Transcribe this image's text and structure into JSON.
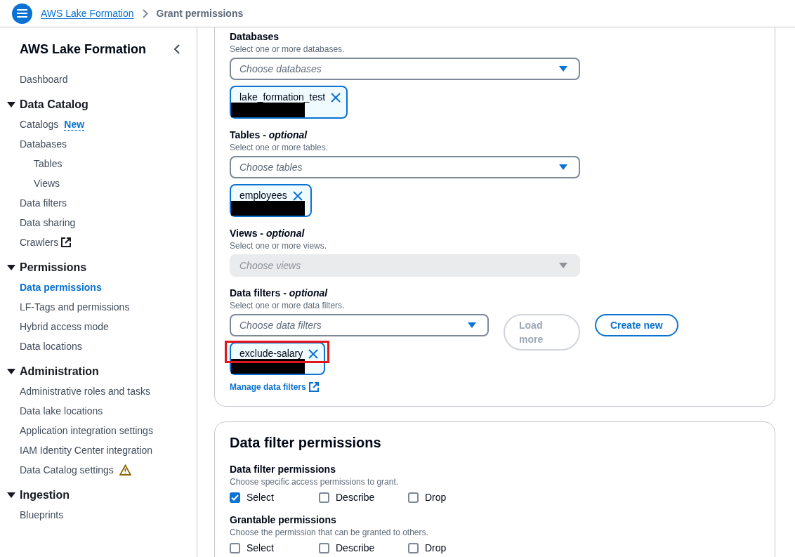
{
  "header": {
    "breadcrumbs": [
      {
        "label": "AWS Lake Formation",
        "link": true
      },
      {
        "label": "Grant permissions",
        "link": false
      }
    ]
  },
  "sidebar": {
    "title": "AWS Lake Formation",
    "items": [
      {
        "label": "Dashboard",
        "selected": false
      },
      {
        "label": "Data Catalog",
        "kind": "section",
        "expanded": true,
        "children": [
          {
            "label": "Catalogs",
            "selected": false,
            "badge": "New"
          },
          {
            "label": "Databases",
            "selected": false,
            "children": [
              {
                "label": "Tables",
                "selected": false
              },
              {
                "label": "Views",
                "selected": false
              }
            ]
          },
          {
            "label": "Data filters",
            "selected": false
          },
          {
            "label": "Data sharing",
            "selected": false
          },
          {
            "label": "Crawlers",
            "selected": false,
            "kind": "external"
          }
        ]
      },
      {
        "label": "Permissions",
        "kind": "section",
        "expanded": true,
        "children": [
          {
            "label": "Data permissions",
            "selected": true
          },
          {
            "label": "LF-Tags and permissions",
            "selected": false
          },
          {
            "label": "Hybrid access mode",
            "selected": false
          },
          {
            "label": "Data locations",
            "selected": false
          }
        ]
      },
      {
        "label": "Administration",
        "kind": "section",
        "expanded": true,
        "children": [
          {
            "label": "Administrative roles and tasks",
            "selected": false
          },
          {
            "label": "Data lake locations",
            "selected": false
          },
          {
            "label": "Application integration settings",
            "selected": false
          },
          {
            "label": "IAM Identity Center integration",
            "selected": false
          },
          {
            "label": "Data Catalog settings",
            "selected": false,
            "kind": "warning"
          }
        ]
      },
      {
        "label": "Ingestion",
        "kind": "section",
        "expanded": true,
        "children": [
          {
            "label": "Blueprints",
            "selected": false
          }
        ]
      }
    ]
  },
  "resource_card": {
    "fields": [
      {
        "label": "Databases",
        "description": "Select one or more databases.",
        "placeholder": "Choose databases",
        "disabled": false,
        "tokens": [
          {
            "label": "lake_formation_test",
            "highlighted": false
          }
        ]
      },
      {
        "label": "Tables - *optional*",
        "description": "Select one or more tables.",
        "placeholder": "Choose tables",
        "disabled": false,
        "tokens": [
          {
            "label": "employees",
            "highlighted": false
          }
        ]
      },
      {
        "label": "Views - *optional*",
        "description": "Select one or more views.",
        "placeholder": "Choose views",
        "disabled": true
      },
      {
        "label": "Data filters - *optional*",
        "description": "Select one or more data filters.",
        "placeholder": "Choose data filters",
        "disabled": false,
        "buttons": [
          {
            "label": "Load more",
            "disabled": true
          },
          {
            "label": "Create new",
            "disabled": false
          }
        ],
        "tokens": [
          {
            "label": "exclude-salary",
            "highlighted": true
          }
        ]
      }
    ],
    "link": "Manage data filters"
  },
  "permissions_card": {
    "title": "Data filter permissions",
    "groups": [
      {
        "label": "Data filter permissions",
        "description": "Choose specific access permissions to grant.",
        "options": [
          {
            "label": "Select",
            "checked": true
          },
          {
            "label": "Describe",
            "checked": false
          },
          {
            "label": "Drop",
            "checked": false
          }
        ]
      },
      {
        "label": "Grantable permissions",
        "description": "Choose the permission that can be granted to others.",
        "options": [
          {
            "label": "Select",
            "checked": false
          },
          {
            "label": "Describe",
            "checked": false
          },
          {
            "label": "Drop",
            "checked": false
          }
        ]
      }
    ]
  }
}
